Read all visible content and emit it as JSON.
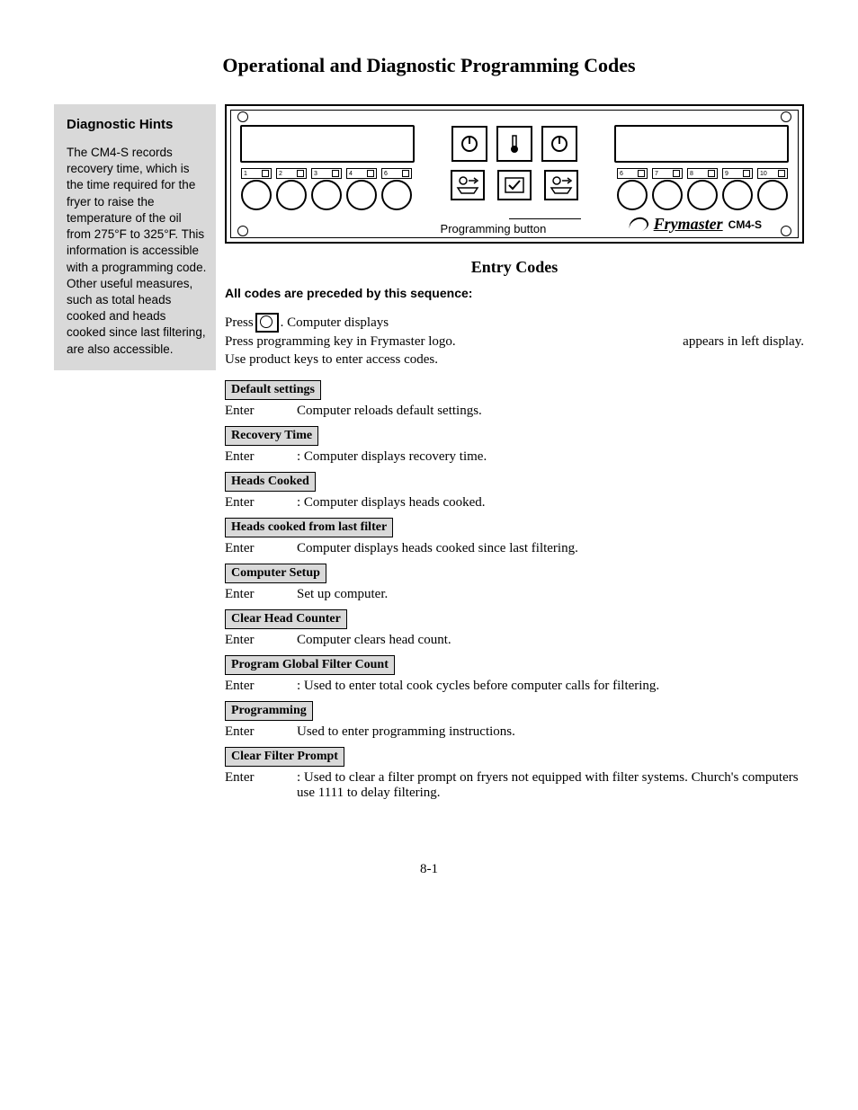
{
  "page_title": "Operational and Diagnostic Programming Codes",
  "sidebar": {
    "heading": "Diagnostic Hints",
    "body": "The CM4-S records recovery time, which is the time required for the fryer to raise the temperature of the oil from 275°F to 325°F. This information is accessible with a programming code. Other useful measures, such as total heads cooked and heads cooked since last filtering, are also accessible."
  },
  "panel": {
    "product_buttons_left": [
      "1",
      "2",
      "3",
      "4",
      "6"
    ],
    "product_buttons_right": [
      "6",
      "7",
      "8",
      "9",
      "10"
    ],
    "programming_label": "Programming button",
    "logo": "Frymaster",
    "model": "CM4-S"
  },
  "entry_codes_title": "Entry Codes",
  "lead": "All codes are preceded by this sequence:",
  "intro": {
    "line1_a": "Press ",
    "line1_b": ". Computer displays",
    "line2_left": "Press programming key in Frymaster logo.",
    "line2_right": "appears in left display.",
    "line3": "Use product keys to enter access codes."
  },
  "sections": [
    {
      "head": "Default settings",
      "enter": "Enter",
      "desc": "Computer reloads default settings."
    },
    {
      "head": "Recovery Time",
      "enter": "Enter",
      "desc": ": Computer displays recovery time."
    },
    {
      "head": "Heads Cooked",
      "enter": "Enter",
      "desc": ": Computer displays heads cooked."
    },
    {
      "head": "Heads cooked from last filter",
      "enter": "Enter",
      "desc": "Computer displays heads cooked since last filtering."
    },
    {
      "head": "Computer Setup",
      "enter": "Enter",
      "desc": "Set up computer."
    },
    {
      "head": "Clear Head Counter",
      "enter": "Enter",
      "desc": "Computer clears head count."
    },
    {
      "head": "Program Global Filter Count",
      "enter": "Enter",
      "desc": ": Used to enter total cook cycles before computer calls for filtering."
    },
    {
      "head": "Programming",
      "enter": "Enter",
      "desc": "Used to enter programming instructions."
    },
    {
      "head": "Clear Filter Prompt",
      "enter": "Enter",
      "desc": ": Used to clear a filter prompt on fryers not equipped with filter systems. Church's computers use 1111 to delay filtering."
    }
  ],
  "page_number": "8-1"
}
